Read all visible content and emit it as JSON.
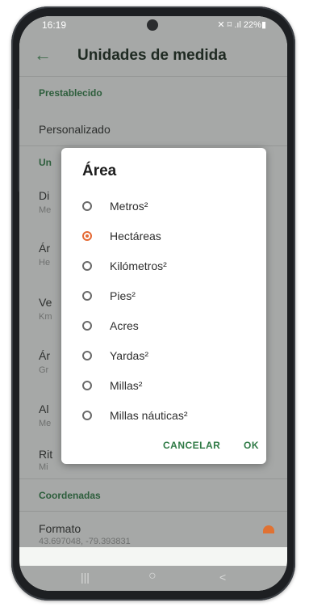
{
  "status_bar": {
    "time": "16:19",
    "right_icons": "✕ ⌑ .ıl 22%▮"
  },
  "app_bar": {
    "back_icon": "←",
    "title": "Unidades de medida"
  },
  "sections": {
    "preset_header": "Prestablecido",
    "preset_value": "Personalizado",
    "units_header_partial": "Un",
    "coords_header": "Coordenadas",
    "format_title": "Formato",
    "format_value": "43.697048, -79.393831"
  },
  "background_rows": [
    {
      "title": "Di",
      "sub": "Me"
    },
    {
      "title": "Ár",
      "sub": "He"
    },
    {
      "title": "Ve",
      "sub": "Km"
    },
    {
      "title": "Ár",
      "sub": "Gr"
    },
    {
      "title": "Al",
      "sub": "Me"
    },
    {
      "title": "Rit",
      "sub": "Mi"
    }
  ],
  "dialog": {
    "title": "Área",
    "options": [
      {
        "label": "Metros²",
        "selected": false
      },
      {
        "label": "Hectáreas",
        "selected": true
      },
      {
        "label": "Kilómetros²",
        "selected": false
      },
      {
        "label": "Pies²",
        "selected": false
      },
      {
        "label": "Acres",
        "selected": false
      },
      {
        "label": "Yardas²",
        "selected": false
      },
      {
        "label": "Millas²",
        "selected": false
      },
      {
        "label": "Millas náuticas²",
        "selected": false
      }
    ],
    "cancel_label": "CANCELAR",
    "ok_label": "OK"
  },
  "nav_bar": {
    "recents_icon": "|||",
    "home_icon": "○",
    "back_icon": "<"
  },
  "colors": {
    "accent": "#e56a35",
    "primary": "#2f7a46",
    "scrim": "#a6a8a7"
  }
}
